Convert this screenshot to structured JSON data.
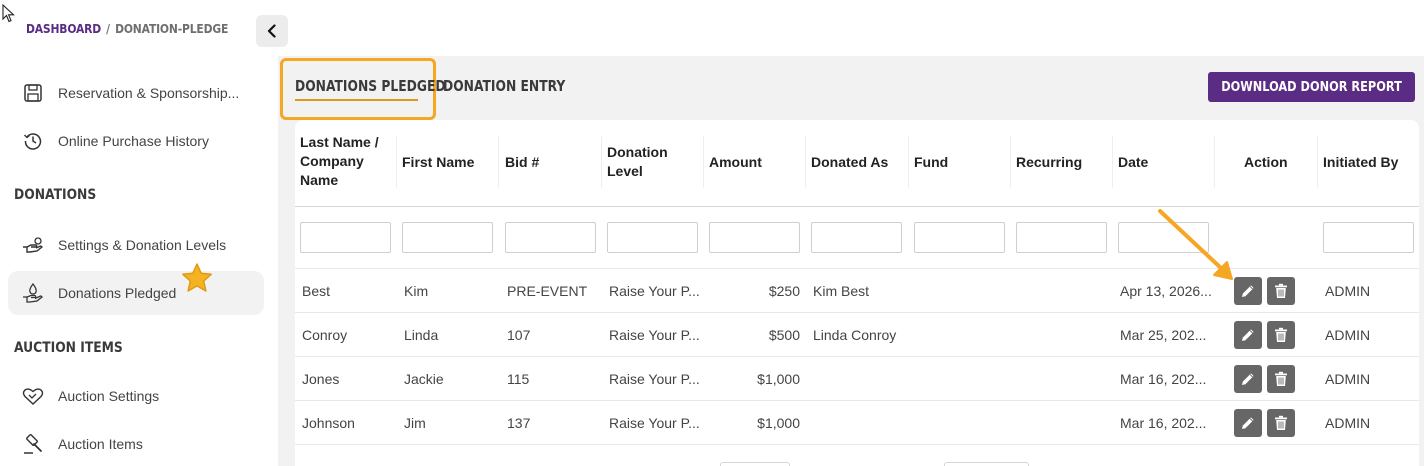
{
  "breadcrumb": {
    "root": "DASHBOARD",
    "separator": "/",
    "current": "DONATION-PLEDGE"
  },
  "sidebar": {
    "items": [
      {
        "label": "Reservation & Sponsorship...",
        "icon": "floppy-disk-icon"
      },
      {
        "label": "Online Purchase History",
        "icon": "history-clock-icon"
      }
    ],
    "donations": {
      "title": "DONATIONS",
      "items": [
        {
          "label": "Settings & Donation Levels",
          "icon": "hand-coin-icon"
        },
        {
          "label": "Donations Pledged",
          "icon": "hand-droplet-icon",
          "active": true
        }
      ]
    },
    "auction": {
      "title": "AUCTION ITEMS",
      "items": [
        {
          "label": "Auction Settings",
          "icon": "handshake-heart-icon"
        },
        {
          "label": "Auction Items",
          "icon": "gavel-icon"
        }
      ]
    }
  },
  "tabs": {
    "active": "DONATIONS PLEDGED",
    "other": "DONATION ENTRY"
  },
  "download_button": "DOWNLOAD DONOR REPORT",
  "table": {
    "columns": [
      "Last Name / Company Name",
      "First Name",
      "Bid #",
      "Donation Level",
      "Amount",
      "Donated As",
      "Fund",
      "Recurring",
      "Date",
      "Action",
      "Initiated By"
    ],
    "rows": [
      {
        "last": "Best",
        "first": "Kim",
        "bid": "PRE-EVENT",
        "level": "Raise Your P...",
        "amount": "$250",
        "donated_as": "Kim Best",
        "fund": "",
        "recurring": "",
        "date": "Apr 13, 2026...",
        "initiated_by": "ADMIN"
      },
      {
        "last": "Conroy",
        "first": "Linda",
        "bid": "107",
        "level": "Raise Your P...",
        "amount": "$500",
        "donated_as": "Linda Conroy",
        "fund": "",
        "recurring": "",
        "date": "Mar 25, 202...",
        "initiated_by": "ADMIN"
      },
      {
        "last": "Jones",
        "first": "Jackie",
        "bid": "115",
        "level": "Raise Your P...",
        "amount": "$1,000",
        "donated_as": "",
        "fund": "",
        "recurring": "",
        "date": "Mar 16, 202...",
        "initiated_by": "ADMIN"
      },
      {
        "last": "Johnson",
        "first": "Jim",
        "bid": "137",
        "level": "Raise Your P...",
        "amount": "$1,000",
        "donated_as": "",
        "fund": "",
        "recurring": "",
        "date": "Mar 16, 202...",
        "initiated_by": "ADMIN"
      }
    ]
  },
  "colors": {
    "brand_purple": "#5b2c83",
    "highlight_orange": "#f5a623",
    "action_gray": "#666666"
  }
}
